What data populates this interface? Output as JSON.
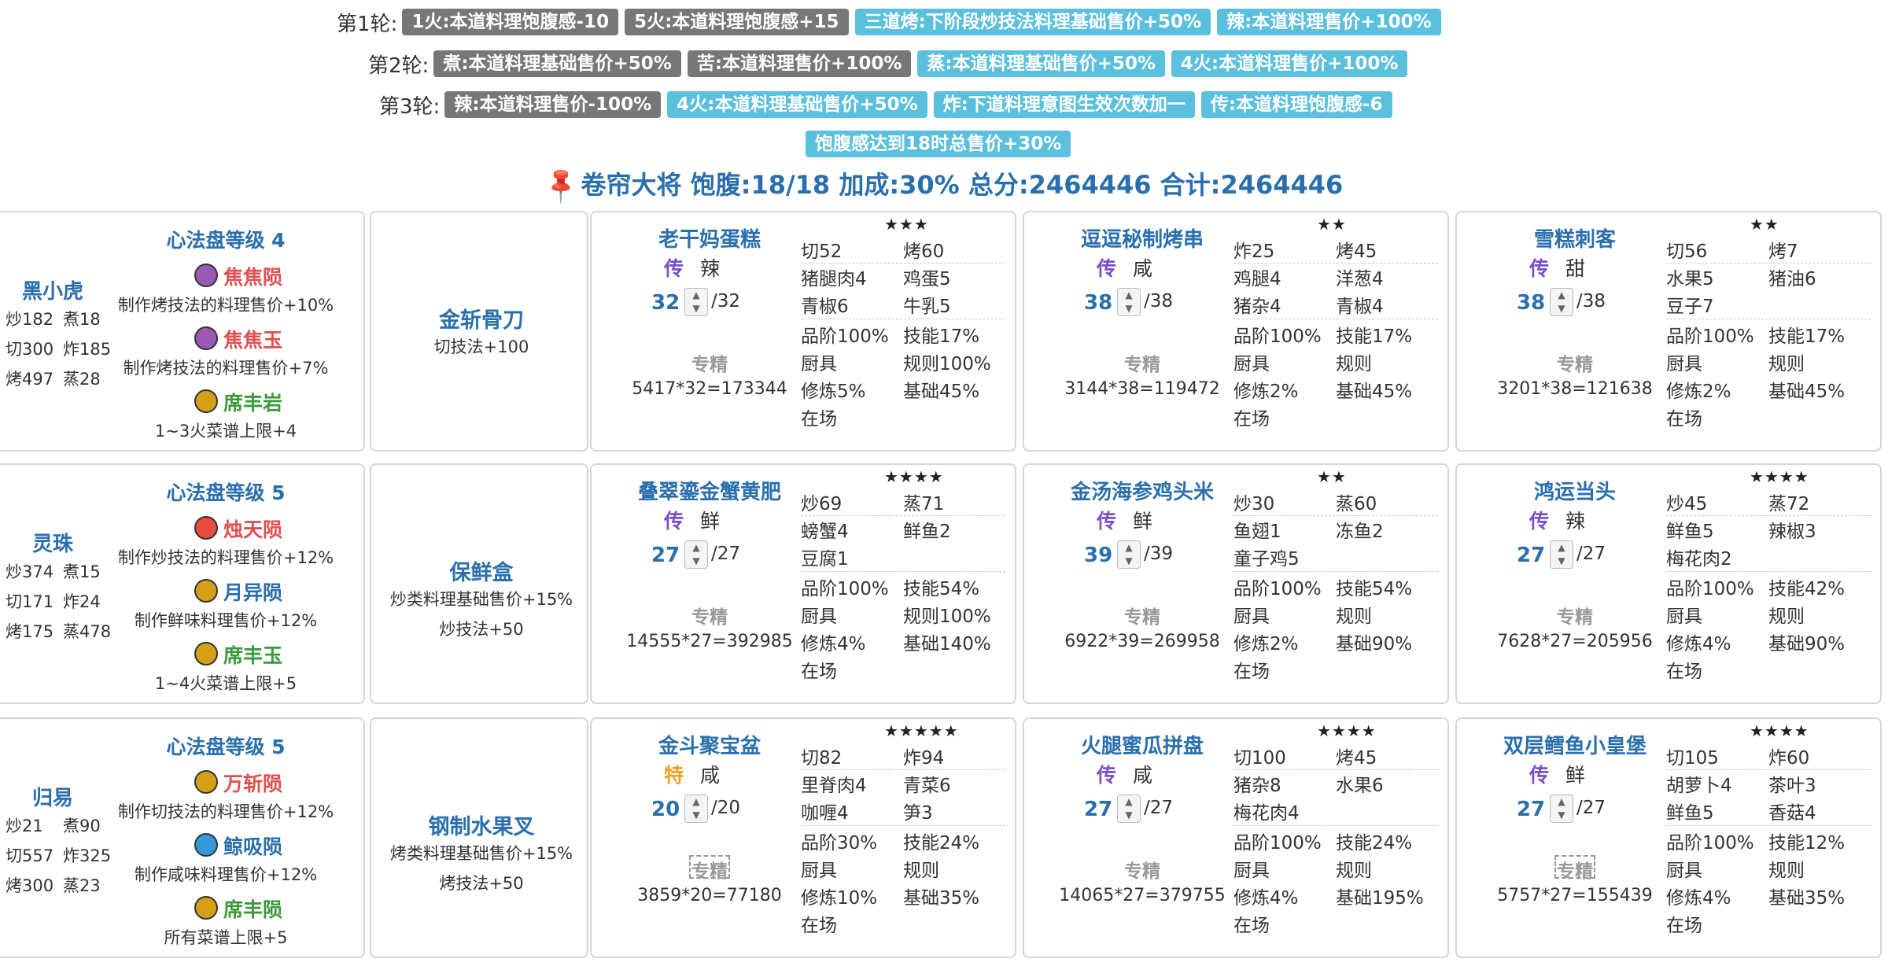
{
  "rounds": [
    {
      "label": "第1轮:",
      "rules": [
        {
          "text": "1火:本道料理饱腹感-10",
          "color": "gray"
        },
        {
          "text": "5火:本道料理饱腹感+15",
          "color": "gray"
        },
        {
          "text": "三道烤:下阶段炒技法料理基础售价+50%",
          "color": "blue"
        },
        {
          "text": "辣:本道料理售价+100%",
          "color": "blue"
        }
      ]
    },
    {
      "label": "第2轮:",
      "rules": [
        {
          "text": "煮:本道料理基础售价+50%",
          "color": "gray"
        },
        {
          "text": "苦:本道料理售价+100%",
          "color": "gray"
        },
        {
          "text": "蒸:本道料理基础售价+50%",
          "color": "blue"
        },
        {
          "text": "4火:本道料理售价+100%",
          "color": "blue"
        }
      ]
    },
    {
      "label": "第3轮:",
      "rules": [
        {
          "text": "辣:本道料理售价-100%",
          "color": "gray"
        },
        {
          "text": "4火:本道料理基础售价+50%",
          "color": "blue"
        },
        {
          "text": "炸:下道料理意图生效次数加一",
          "color": "blue"
        },
        {
          "text": "传:本道料理饱腹感-6",
          "color": "blue"
        }
      ]
    }
  ],
  "extra_rule": {
    "text": "饱腹感达到18时总售价+30%",
    "color": "blue"
  },
  "summary": {
    "icon": "pin-icon",
    "text": "卷帘大将 饱腹:18/18 加成:30% 总分:2464446 合计:2464446"
  },
  "rows": [
    {
      "chef": {
        "name": "黑小虎",
        "stats": [
          "炒182",
          "煮18",
          "切300",
          "炸185",
          "烤497",
          "蒸28"
        ]
      },
      "disk": {
        "level": "心法盘等级 4",
        "items": [
          {
            "name": "焦焦陨",
            "color": "#e05050",
            "icon": "purple-jade-icon",
            "desc": "制作烤技法的料理售价+10%"
          },
          {
            "name": "焦焦玉",
            "color": "#e05050",
            "icon": "purple-jade-icon",
            "desc": "制作烤技法的料理售价+7%"
          },
          {
            "name": "席丰岩",
            "color": "#3a9a3a",
            "icon": "gold-jade-icon",
            "desc": "1~3火菜谱上限+4"
          }
        ]
      },
      "equip": {
        "name": "金斩骨刀",
        "descs": [
          "切技法+100"
        ]
      },
      "recipes": [
        {
          "name": "老干妈蛋糕",
          "rarity": "传",
          "rarity_color": "#7a4fc9",
          "flavor": "辣",
          "qty": "32",
          "max": "/32",
          "spec": "专精",
          "spec_dashed": false,
          "formula": "5417*32=173344",
          "stars": "★★★",
          "ingr": [
            "切52",
            "烤60",
            "猪腿肉4",
            "鸡蛋5",
            "青椒6",
            "牛乳5"
          ],
          "props": [
            "品阶100%",
            "技能17%",
            "厨具",
            "规则100%",
            "修炼5%",
            "基础45%",
            "在场",
            ""
          ]
        },
        {
          "name": "逗逗秘制烤串",
          "rarity": "传",
          "rarity_color": "#7a4fc9",
          "flavor": "咸",
          "qty": "38",
          "max": "/38",
          "spec": "专精",
          "spec_dashed": false,
          "formula": "3144*38=119472",
          "stars": "★★",
          "ingr": [
            "炸25",
            "烤45",
            "鸡腿4",
            "洋葱4",
            "猪杂4",
            "青椒4"
          ],
          "props": [
            "品阶100%",
            "技能17%",
            "厨具",
            "规则",
            "修炼2%",
            "基础45%",
            "在场",
            ""
          ]
        },
        {
          "name": "雪糕刺客",
          "rarity": "传",
          "rarity_color": "#7a4fc9",
          "flavor": "甜",
          "qty": "38",
          "max": "/38",
          "spec": "专精",
          "spec_dashed": false,
          "formula": "3201*38=121638",
          "stars": "★★",
          "ingr": [
            "切56",
            "烤7",
            "水果5",
            "猪油6",
            "豆子7",
            ""
          ],
          "props": [
            "品阶100%",
            "技能17%",
            "厨具",
            "规则",
            "修炼2%",
            "基础45%",
            "在场",
            ""
          ]
        }
      ]
    },
    {
      "chef": {
        "name": "灵珠",
        "stats": [
          "炒374",
          "煮15",
          "切171",
          "炸24",
          "烤175",
          "蒸478"
        ]
      },
      "disk": {
        "level": "心法盘等级 5",
        "items": [
          {
            "name": "烛天陨",
            "color": "#e05050",
            "icon": "red-jade-icon",
            "desc": "制作炒技法的料理售价+12%"
          },
          {
            "name": "月异陨",
            "color": "#2a6fad",
            "icon": "gold-jade-icon",
            "desc": "制作鲜味料理售价+12%"
          },
          {
            "name": "席丰玉",
            "color": "#3a9a3a",
            "icon": "gold-jade-icon",
            "desc": "1~4火菜谱上限+5"
          }
        ]
      },
      "equip": {
        "name": "保鲜盒",
        "descs": [
          "炒类料理基础售价+15%",
          "炒技法+50"
        ]
      },
      "recipes": [
        {
          "name": "叠翠鎏金蟹黄肥",
          "rarity": "传",
          "rarity_color": "#7a4fc9",
          "flavor": "鲜",
          "qty": "27",
          "max": "/27",
          "spec": "专精",
          "spec_dashed": false,
          "formula": "14555*27=392985",
          "stars": "★★★★",
          "ingr": [
            "炒69",
            "蒸71",
            "螃蟹4",
            "鲜鱼2",
            "豆腐1",
            ""
          ],
          "props": [
            "品阶100%",
            "技能54%",
            "厨具",
            "规则100%",
            "修炼4%",
            "基础140%",
            "在场",
            ""
          ]
        },
        {
          "name": "金汤海参鸡头米",
          "rarity": "传",
          "rarity_color": "#7a4fc9",
          "flavor": "鲜",
          "qty": "39",
          "max": "/39",
          "spec": "专精",
          "spec_dashed": false,
          "formula": "6922*39=269958",
          "stars": "★★",
          "ingr": [
            "炒30",
            "蒸60",
            "鱼翅1",
            "冻鱼2",
            "童子鸡5",
            ""
          ],
          "props": [
            "品阶100%",
            "技能54%",
            "厨具",
            "规则",
            "修炼2%",
            "基础90%",
            "在场",
            ""
          ]
        },
        {
          "name": "鸿运当头",
          "rarity": "传",
          "rarity_color": "#7a4fc9",
          "flavor": "辣",
          "qty": "27",
          "max": "/27",
          "spec": "专精",
          "spec_dashed": false,
          "formula": "7628*27=205956",
          "stars": "★★★★",
          "ingr": [
            "炒45",
            "蒸72",
            "鲜鱼5",
            "辣椒3",
            "梅花肉2",
            ""
          ],
          "props": [
            "品阶100%",
            "技能42%",
            "厨具",
            "规则",
            "修炼4%",
            "基础90%",
            "在场",
            ""
          ]
        }
      ]
    },
    {
      "chef": {
        "name": "归易",
        "stats": [
          "炒21",
          "煮90",
          "切557",
          "炸325",
          "烤300",
          "蒸23"
        ]
      },
      "disk": {
        "level": "心法盘等级 5",
        "items": [
          {
            "name": "万斩陨",
            "color": "#e05050",
            "icon": "gold-jade-icon",
            "desc": "制作切技法的料理售价+12%"
          },
          {
            "name": "鲸吸陨",
            "color": "#2a6fad",
            "icon": "blue-jade-icon",
            "desc": "制作咸味料理售价+12%"
          },
          {
            "name": "席丰陨",
            "color": "#3a9a3a",
            "icon": "gold-jade-icon",
            "desc": "所有菜谱上限+5"
          }
        ]
      },
      "equip": {
        "name": "钢制水果叉",
        "descs": [
          "烤类料理基础售价+15%",
          "烤技法+50"
        ]
      },
      "recipes": [
        {
          "name": "金斗聚宝盆",
          "rarity": "特",
          "rarity_color": "#f0a020",
          "flavor": "咸",
          "qty": "20",
          "max": "/20",
          "spec": "专精",
          "spec_dashed": true,
          "formula": "3859*20=77180",
          "stars": "★★★★★",
          "ingr": [
            "切82",
            "炸94",
            "里脊肉4",
            "青菜6",
            "咖喱4",
            "笋3"
          ],
          "props": [
            "品阶30%",
            "技能24%",
            "厨具",
            "规则",
            "修炼10%",
            "基础35%",
            "在场",
            ""
          ]
        },
        {
          "name": "火腿蜜瓜拼盘",
          "rarity": "传",
          "rarity_color": "#7a4fc9",
          "flavor": "咸",
          "qty": "27",
          "max": "/27",
          "spec": "专精",
          "spec_dashed": false,
          "formula": "14065*27=379755",
          "stars": "★★★★",
          "ingr": [
            "切100",
            "烤45",
            "猪杂8",
            "水果6",
            "梅花肉4",
            ""
          ],
          "props": [
            "品阶100%",
            "技能24%",
            "厨具",
            "规则",
            "修炼4%",
            "基础195%",
            "在场",
            ""
          ]
        },
        {
          "name": "双层鳕鱼小皇堡",
          "rarity": "传",
          "rarity_color": "#7a4fc9",
          "flavor": "鲜",
          "qty": "27",
          "max": "/27",
          "spec": "专精",
          "spec_dashed": true,
          "formula": "5757*27=155439",
          "stars": "★★★★",
          "ingr": [
            "切105",
            "炸60",
            "胡萝卜4",
            "茶叶3",
            "鲜鱼5",
            "香菇4"
          ],
          "props": [
            "品阶100%",
            "技能12%",
            "厨具",
            "规则",
            "修炼4%",
            "基础35%",
            "在场",
            ""
          ]
        }
      ]
    }
  ]
}
